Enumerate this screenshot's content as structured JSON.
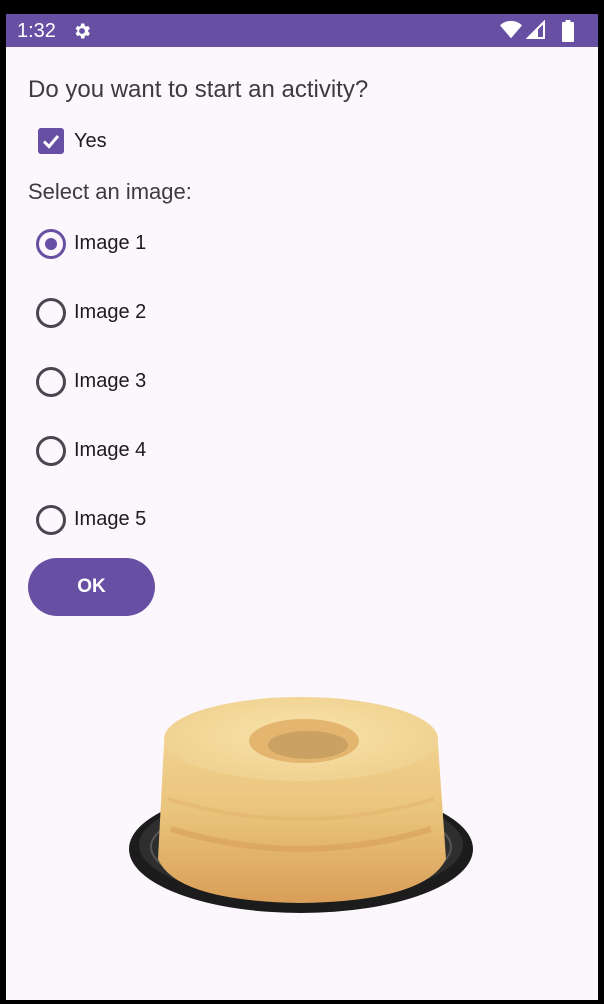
{
  "status_bar": {
    "time": "1:32",
    "icons": [
      "gear-icon",
      "wifi-icon",
      "signal-icon",
      "battery-icon"
    ]
  },
  "form": {
    "question": "Do you want to start an activity?",
    "checkbox": {
      "label": "Yes",
      "checked": true
    },
    "select_label": "Select an image:",
    "options": [
      {
        "label": "Image 1",
        "selected": true
      },
      {
        "label": "Image 2",
        "selected": false
      },
      {
        "label": "Image 3",
        "selected": false
      },
      {
        "label": "Image 4",
        "selected": false
      },
      {
        "label": "Image 5",
        "selected": false
      }
    ],
    "ok_label": "OK"
  },
  "image": {
    "subject": "chiffon cake on black plate"
  },
  "colors": {
    "accent": "#6750a4",
    "background": "#fcf7fc",
    "text": "#1d1b20"
  }
}
